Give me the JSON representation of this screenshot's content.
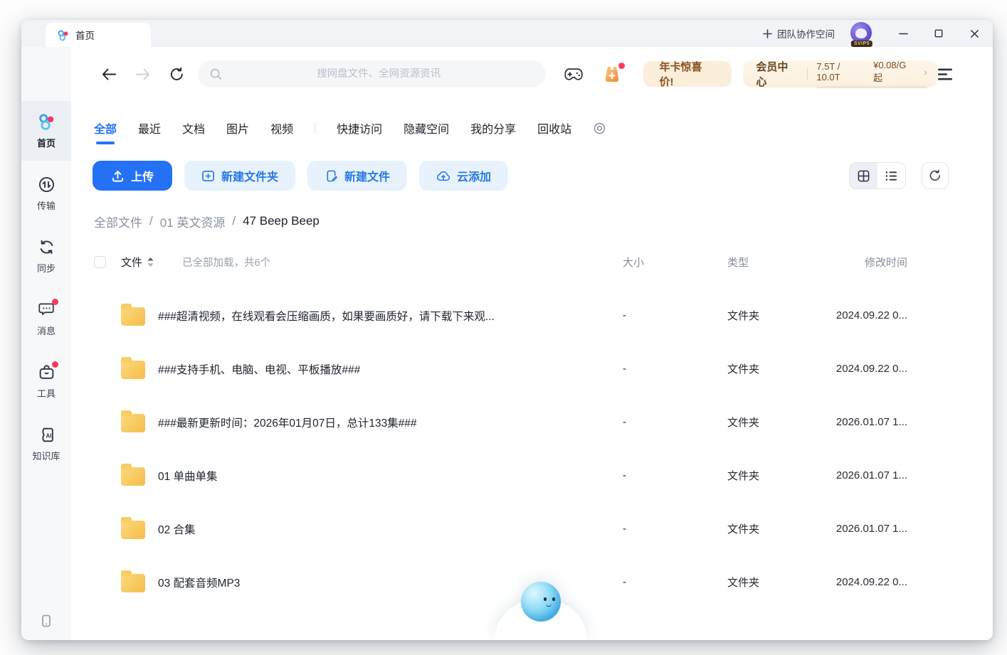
{
  "titlebar": {
    "tab_title": "首页",
    "team_space_label": "团队协作空间",
    "avatar_badge": "SVIP5"
  },
  "toolbar": {
    "search_placeholder": "搜网盘文件、全网资源资讯",
    "promo_label": "年卡惊喜价!",
    "member_label": "会员中心",
    "storage_text": "7.5T / 10.0T",
    "price_text": "¥0.08/G起",
    "chevron": "›"
  },
  "nav_tabs": [
    "全部",
    "最近",
    "文档",
    "图片",
    "视频",
    "快捷访问",
    "隐藏空间",
    "我的分享",
    "回收站"
  ],
  "actions": {
    "upload": "上传",
    "new_folder": "新建文件夹",
    "new_file": "新建文件",
    "cloud_add": "云添加"
  },
  "breadcrumb": {
    "root": "全部文件",
    "parent": "01 英文资源",
    "current": "47 Beep Beep",
    "separator": "/"
  },
  "file_table": {
    "file_header": "文件",
    "load_status": "已全部加载，共6个",
    "size_header": "大小",
    "type_header": "类型",
    "modified_header": "修改时间",
    "rows": [
      {
        "name": "###超清视频，在线观看会压缩画质，如果要画质好，请下载下来观...",
        "size": "-",
        "type": "文件夹",
        "modified": "2024.09.22 0..."
      },
      {
        "name": "###支持手机、电脑、电视、平板播放###",
        "size": "-",
        "type": "文件夹",
        "modified": "2024.09.22 0..."
      },
      {
        "name": "###最新更新时间：2026年01月07日，总计133集###",
        "size": "-",
        "type": "文件夹",
        "modified": "2026.01.07 1..."
      },
      {
        "name": "01 单曲单集",
        "size": "-",
        "type": "文件夹",
        "modified": "2026.01.07 1..."
      },
      {
        "name": "02 合集",
        "size": "-",
        "type": "文件夹",
        "modified": "2026.01.07 1..."
      },
      {
        "name": "03 配套音频MP3",
        "size": "-",
        "type": "文件夹",
        "modified": "2024.09.22 0..."
      }
    ]
  },
  "sidebar": {
    "items": [
      {
        "label": "首页"
      },
      {
        "label": "传输"
      },
      {
        "label": "同步"
      },
      {
        "label": "消息"
      },
      {
        "label": "工具"
      },
      {
        "label": "知识库"
      }
    ]
  },
  "colors": {
    "accent": "#2471f5",
    "accent_button": "#2778f7",
    "accent_light": "#e8f2fd",
    "accent_text": "#2779e3",
    "promo_bg": "#fbeeda",
    "promo_text": "#8a5220",
    "progress_orange": "#d98b3f",
    "folder_yellow": "#f5bd4a",
    "badge_red": "#fb3b5c",
    "logo_blue": "#3b9af0",
    "logo_pink": "#ec3b6e",
    "logo_cyan": "#54c3f1"
  }
}
